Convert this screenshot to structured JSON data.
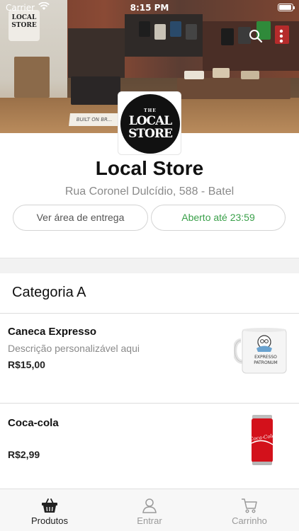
{
  "status_bar": {
    "carrier": "Carrier",
    "time": "8:15 PM"
  },
  "hero": {
    "sign_text": "LOCAL STORE",
    "banner_text": "BUILT ON BR..."
  },
  "store": {
    "logo_the": "THE",
    "logo_line1": "LOCAL",
    "logo_line2": "STORE",
    "name": "Local Store",
    "address": "Rua Coronel Dulcídio, 588 - Batel",
    "delivery_button": "Ver área de entrega",
    "open_status": "Aberto até 23:59"
  },
  "colors": {
    "open_green": "#3aa04a",
    "text_gray": "#8a8a8a",
    "divider": "#dcdcdc"
  },
  "category": {
    "title": "Categoria A"
  },
  "products": [
    {
      "name": "Caneca Expresso",
      "description": "Descrição personalizável aqui",
      "price": "R$15,00",
      "mug_text_1": "EXPRESSO",
      "mug_text_2": "PATRONUM",
      "icon": "mug-image"
    },
    {
      "name": "Coca-cola",
      "description": "",
      "price": "R$2,99",
      "can_text": "Coca-Cola",
      "icon": "soda-can-image"
    }
  ],
  "tabbar": {
    "tabs": [
      {
        "label": "Produtos",
        "icon": "basket-icon",
        "active": true
      },
      {
        "label": "Entrar",
        "icon": "user-icon",
        "active": false
      },
      {
        "label": "Carrinho",
        "icon": "cart-icon",
        "active": false
      }
    ]
  }
}
